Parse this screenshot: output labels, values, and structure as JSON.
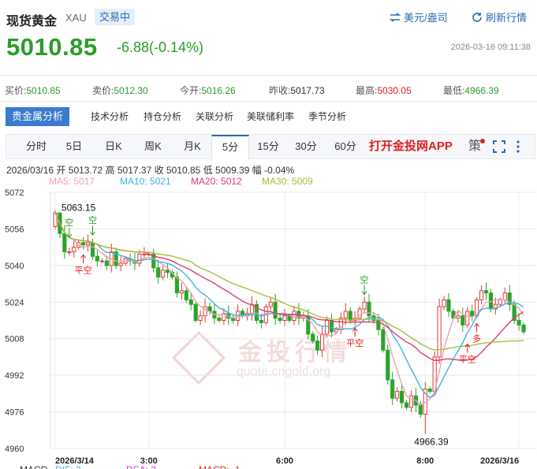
{
  "header": {
    "title": "现货黄金",
    "symbol": "XAU",
    "status": "交易中",
    "unit_toggle": "美元/盎司",
    "refresh": "刷新行情"
  },
  "quote": {
    "price": "5010.85",
    "change": "-6.88(-0.14%)",
    "timestamp": "2026-03-16 09:11:38"
  },
  "stats": [
    {
      "label": "买价:",
      "value": "5010.85",
      "color": "#2a9d2a"
    },
    {
      "label": "卖价:",
      "value": "5012.30",
      "color": "#2a9d2a"
    },
    {
      "label": "今开:",
      "value": "5016.26",
      "color": "#2a9d2a"
    },
    {
      "label": "昨收:",
      "value": "5017.73",
      "color": "#333333"
    },
    {
      "label": "最高:",
      "value": "5030.05",
      "color": "#e02020"
    },
    {
      "label": "最低:",
      "value": "4966.39",
      "color": "#2a9d2a"
    }
  ],
  "analysis_tabs": [
    "贵金属分析",
    "技术分析",
    "持仓分析",
    "关联分析",
    "美联储利率",
    "季节分析"
  ],
  "period_tabs": [
    "分时",
    "5日",
    "日K",
    "周K",
    "月K",
    "5分",
    "15分",
    "30分",
    "60分"
  ],
  "active_period": "5分",
  "app_link": "打开金投网APP",
  "strategy_icon": "策",
  "ohlc": {
    "date": "2026/03/16",
    "open_label": "开",
    "open": "5013.72",
    "high_label": "高",
    "high": "5017.37",
    "close_label": "收",
    "close": "5010.85",
    "low_label": "低",
    "low": "5009.39",
    "amp_label": "幅",
    "amp": "-0.04%"
  },
  "ma_legend": [
    {
      "name": "MA5: 5017",
      "color": "#f0a0b0"
    },
    {
      "name": "MA10: 5021",
      "color": "#3cb4dc"
    },
    {
      "name": "MA20: 5012",
      "color": "#e23c6e"
    },
    {
      "name": "MA30: 5009",
      "color": "#a8be3c"
    }
  ],
  "macd_legend": [
    "MACD",
    "DIF: 2",
    "DEA: 3",
    "MACD: -1"
  ],
  "watermark": {
    "logo": "Au",
    "text": "金投行情",
    "url": "quote.cngold.org"
  },
  "chart_data": {
    "type": "candlestick",
    "ylim": [
      4960,
      5072
    ],
    "yticks": [
      4960,
      4976,
      4992,
      5008,
      5024,
      5040,
      5056,
      5072
    ],
    "xticks": [
      "2026/3/14",
      "3:00",
      "6:00",
      "8:00",
      "2026/3/16"
    ],
    "xtick_index": [
      0,
      20,
      49,
      79,
      99
    ],
    "high_label": "5063.15",
    "low_label": "4966.39",
    "signals": [
      {
        "text": "空",
        "index": 3,
        "price": 5052,
        "dir": "down",
        "color": "#2a9d2a"
      },
      {
        "text": "空",
        "index": 8,
        "price": 5053,
        "dir": "down",
        "color": "#2a9d2a"
      },
      {
        "text": "平空",
        "index": 6,
        "price": 5045,
        "dir": "up",
        "color": "#e02020"
      },
      {
        "text": "空",
        "index": 66,
        "price": 5027,
        "dir": "down",
        "color": "#2a9d2a"
      },
      {
        "text": "平空",
        "index": 64,
        "price": 5013,
        "dir": "up",
        "color": "#e02020"
      },
      {
        "text": "多",
        "index": 90,
        "price": 5015,
        "dir": "up",
        "color": "#e02020"
      },
      {
        "text": "平空",
        "index": 88,
        "price": 5006,
        "dir": "up",
        "color": "#e02020"
      }
    ],
    "closes": [
      5063,
      5054,
      5046,
      5046,
      5048,
      5050,
      5049,
      5050,
      5044,
      5042,
      5042,
      5040,
      5046,
      5040,
      5041,
      5043,
      5042,
      5041,
      5045,
      5045,
      5045,
      5039,
      5035,
      5038,
      5037,
      5035,
      5028,
      5029,
      5025,
      5023,
      5016,
      5018,
      5022,
      5020,
      5017,
      5016,
      5019,
      5017,
      5016,
      5020,
      5018,
      5019,
      5023,
      5016,
      5015,
      5022,
      5024,
      5017,
      5016,
      5018,
      5016,
      5020,
      5017,
      5018,
      5010,
      5007,
      5003,
      5010,
      5016,
      5011,
      5012,
      5017,
      5020,
      5016,
      5017,
      5021,
      5024,
      5018,
      5016,
      5012,
      5003,
      4990,
      4982,
      4985,
      4980,
      4978,
      4983,
      4979,
      4975,
      4986,
      4985,
      5000,
      5022,
      5025,
      5020,
      5017,
      5018,
      5014,
      5020,
      5018,
      5025,
      5029,
      5028,
      5021,
      5023,
      5025,
      5028,
      5023,
      5016,
      5014,
      5011
    ]
  }
}
